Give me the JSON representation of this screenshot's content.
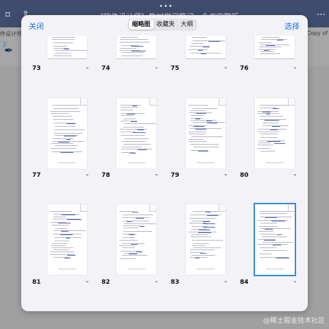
{
  "background": {
    "title": "《软件设计师》教材学习笔记 · 全书完整版",
    "left_label": "件设计师",
    "right_label": "Copy of",
    "dots": "•••",
    "watermark": "@稀土掘金技术社区"
  },
  "modal": {
    "close_label": "关闭",
    "select_label": "选择",
    "tabs": [
      {
        "label": "缩略图",
        "active": true
      },
      {
        "label": "收藏夹",
        "active": false
      },
      {
        "label": "大纲",
        "active": false
      }
    ]
  },
  "pages": [
    {
      "number": "73",
      "selected": false
    },
    {
      "number": "74",
      "selected": false
    },
    {
      "number": "75",
      "selected": false
    },
    {
      "number": "76",
      "selected": false
    },
    {
      "number": "77",
      "selected": false
    },
    {
      "number": "78",
      "selected": false
    },
    {
      "number": "79",
      "selected": false
    },
    {
      "number": "80",
      "selected": false
    },
    {
      "number": "81",
      "selected": false
    },
    {
      "number": "82",
      "selected": false
    },
    {
      "number": "83",
      "selected": false
    },
    {
      "number": "84",
      "selected": true
    }
  ],
  "colors": {
    "accent": "#1677f2",
    "selection": "#2b8ce0"
  }
}
